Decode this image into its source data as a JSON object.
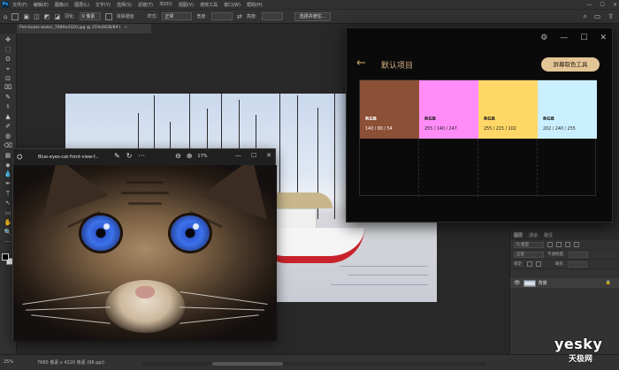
{
  "photoshop": {
    "logo": "Ps",
    "menus": [
      "文件(F)",
      "编辑(E)",
      "图像(I)",
      "图层(L)",
      "文字(Y)",
      "选择(S)",
      "滤镜(T)",
      "3D(D)",
      "视图(V)",
      "增效工具",
      "窗口(W)",
      "帮助(H)"
    ],
    "window_controls": [
      "—",
      "☐",
      "✕"
    ],
    "options": {
      "feather_label": "羽化:",
      "feather_value": "0 像素",
      "antialias_label": "消除锯齿",
      "style_label": "样式:",
      "style_value": "正常",
      "width_label": "宽度:",
      "height_label": "高度:",
      "select_button": "选择并遮住..."
    },
    "doc_tab": "Pier-boats-water_7680x4320.jpg @ 25%(RGB/8#)",
    "doc_tab_close": "×",
    "tools": [
      "✥",
      "⬚",
      "ʘ",
      "⌖",
      "⊡",
      "⌧",
      "✎",
      "⚕",
      "▲",
      "✐",
      "◍",
      "⌫",
      "▦",
      "◆",
      "💧",
      "✒",
      "T",
      "↖",
      "▭",
      "✋",
      "🔍",
      "···"
    ],
    "status": {
      "zoom": "25%",
      "info": "7680 像素 x 4320 像素 (96 ppi)"
    },
    "layers_panel": {
      "tabs": [
        "图层",
        "通道",
        "路径"
      ],
      "kind_search": "Q 类型",
      "mode_label": "正常",
      "opacity_label": "不透明度:",
      "lock_label": "锁定:",
      "fill_label": "填充:",
      "layer_name": "背景",
      "lock_icon": "🔒"
    }
  },
  "viewer": {
    "app_icon": "⛭",
    "title": "Blue-eyes-cat-front-view-f...",
    "tools": [
      "✎",
      "↻",
      "···"
    ],
    "zoom_out": "⊖",
    "zoom_in": "⊕",
    "zoom_value": "17%",
    "window_controls": [
      "—",
      "☐",
      "✕"
    ]
  },
  "color_picker": {
    "window_controls": [
      "⚙",
      "—",
      "☐",
      "✕"
    ],
    "back": "←",
    "title": "默认项目",
    "screen_pick_button": "屏幕取色工具",
    "swatches": [
      {
        "name": "RGB",
        "value": "140 / 80 / 54",
        "color": "#8c5036",
        "text_color": "#ffffff"
      },
      {
        "name": "RGB",
        "value": "255 / 140 / 247",
        "color": "#ff8cf7",
        "text_color": "#1a1a1a"
      },
      {
        "name": "RGB",
        "value": "255 / 215 / 102",
        "color": "#ffd766",
        "text_color": "#1a1a1a"
      },
      {
        "name": "RGB",
        "value": "202 / 240 / 255",
        "color": "#caf0ff",
        "text_color": "#1a1a1a"
      }
    ]
  },
  "watermark": {
    "text": "yesky",
    "sub": "天极网"
  }
}
